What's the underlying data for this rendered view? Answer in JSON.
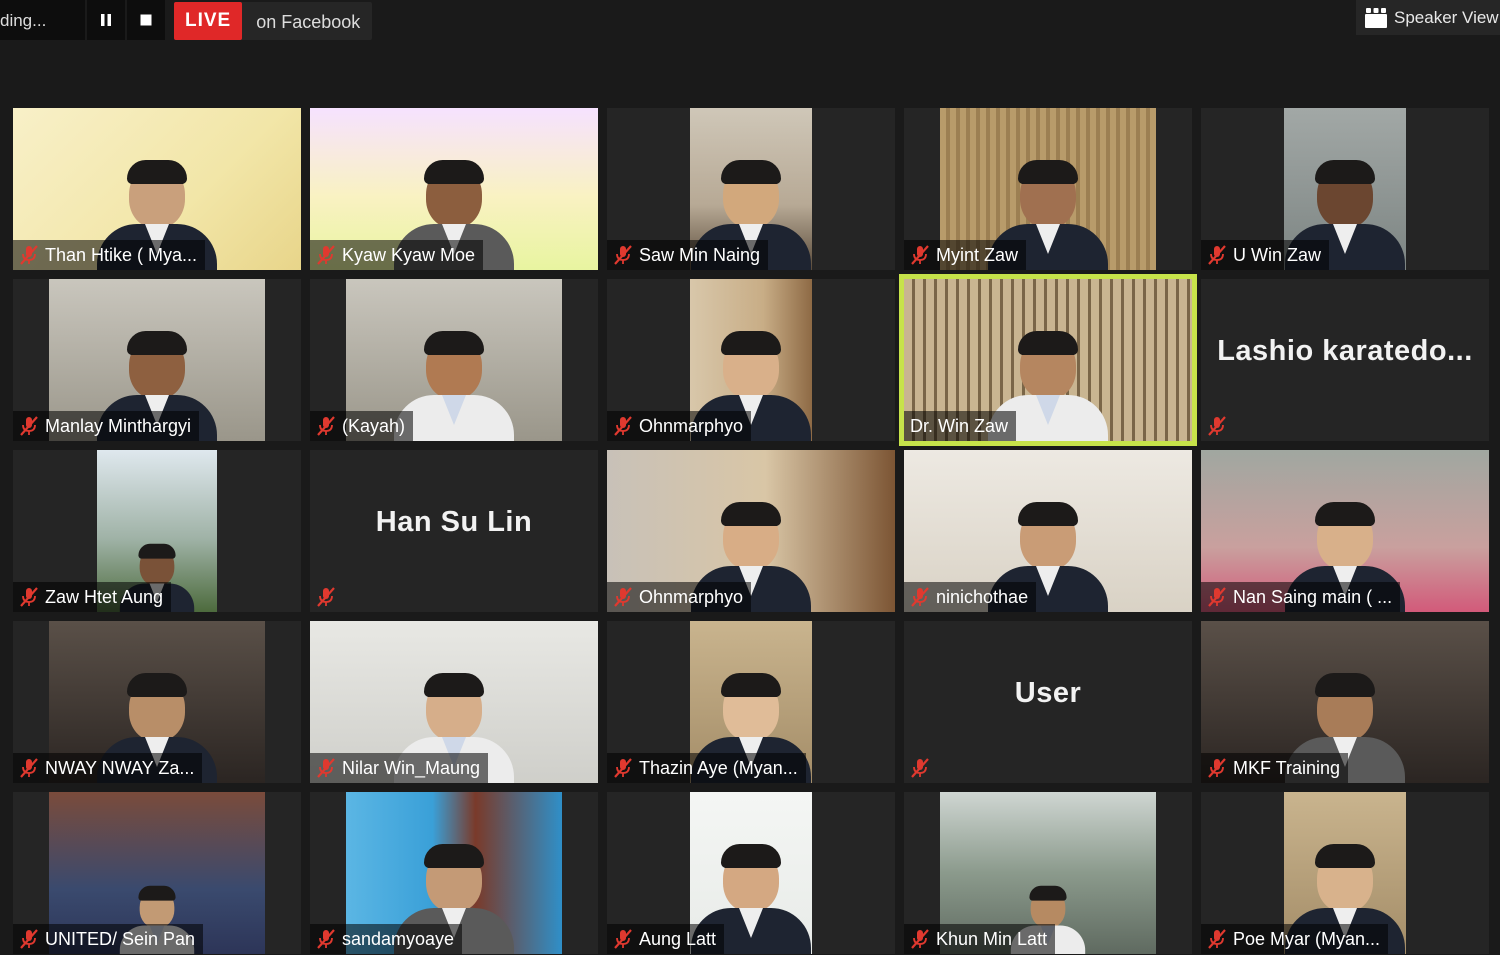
{
  "toolbar": {
    "recording_label": "ding...",
    "pause_icon": "pause-icon",
    "stop_icon": "stop-icon",
    "live_badge": "LIVE",
    "live_destination": "on Facebook",
    "speaker_view_label": "Speaker View",
    "speaker_view_icon": "grid-view-icon"
  },
  "colors": {
    "active_speaker_border": "#c7e34a",
    "live_badge": "#e02828",
    "muted_icon": "#e0392f"
  },
  "participants": [
    {
      "name": "Than Htike ( Mya...",
      "video": true,
      "muted": true
    },
    {
      "name": "Kyaw Kyaw Moe",
      "video": true,
      "muted": true
    },
    {
      "name": "Saw Min Naing",
      "video": true,
      "muted": true
    },
    {
      "name": "Myint Zaw",
      "video": true,
      "muted": true
    },
    {
      "name": "U Win Zaw",
      "video": true,
      "muted": true
    },
    {
      "name": "Manlay Minthargyi",
      "video": true,
      "muted": true
    },
    {
      "name": "(Kayah)",
      "video": true,
      "muted": true
    },
    {
      "name": "Ohnmarphyo",
      "video": true,
      "muted": true
    },
    {
      "name": "Dr. Win Zaw",
      "video": true,
      "muted": false,
      "active_speaker": true
    },
    {
      "name": "",
      "display_name": "Lashio  karatedo...",
      "video": false,
      "muted": true
    },
    {
      "name": "Zaw Htet Aung",
      "video": true,
      "muted": true
    },
    {
      "name": "",
      "display_name": "Han Su Lin",
      "video": false,
      "muted": true
    },
    {
      "name": "Ohnmarphyo",
      "video": true,
      "muted": true
    },
    {
      "name": "ninichothae",
      "video": true,
      "muted": true
    },
    {
      "name": "Nan Saing main ( ...",
      "video": true,
      "muted": true
    },
    {
      "name": "NWAY NWAY Za...",
      "video": true,
      "muted": true
    },
    {
      "name": "Nilar Win_Maung",
      "video": true,
      "muted": true
    },
    {
      "name": "Thazin Aye (Myan...",
      "video": true,
      "muted": true
    },
    {
      "name": "",
      "display_name": "User",
      "video": false,
      "muted": true
    },
    {
      "name": "MKF Training",
      "video": true,
      "muted": true
    },
    {
      "name": "UNITED/ Sein Pan",
      "video": true,
      "muted": true
    },
    {
      "name": "sandamyoaye",
      "video": true,
      "muted": true
    },
    {
      "name": "Aung Latt",
      "video": true,
      "muted": true
    },
    {
      "name": "Khun Min Latt",
      "video": true,
      "muted": true
    },
    {
      "name": "Poe Myar (Myan...",
      "video": true,
      "muted": true
    }
  ]
}
